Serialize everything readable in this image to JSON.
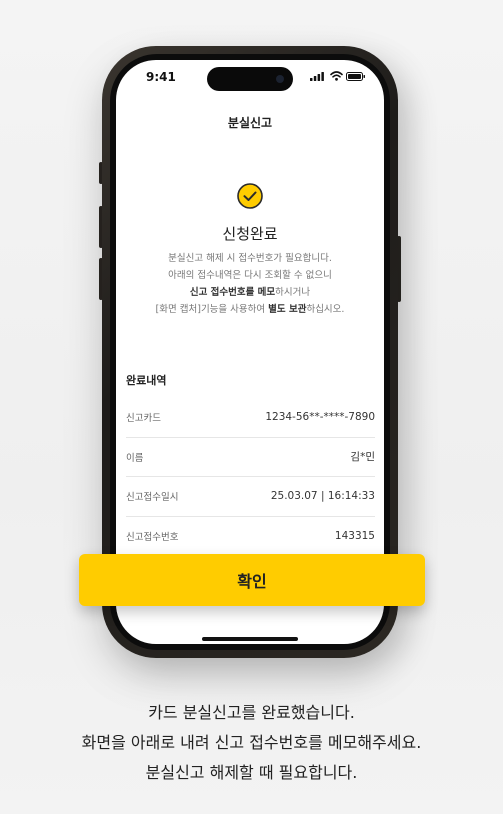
{
  "status_bar": {
    "time": "9:41"
  },
  "screen": {
    "header_title": "분실신고",
    "result_title": "신청완료",
    "description": {
      "line1": "분실신고 해제 시 접수번호가 필요합니다.",
      "line2": "아래의 접수내역은 다시 조회할 수 없으니",
      "line3_bold": "신고 접수번호를 메모",
      "line3_rest": "하시거나",
      "line4_pre": "[화면 캡처]기능을 사용하여 ",
      "line4_bold": "별도 보관",
      "line4_post": "하십시오."
    },
    "details_title": "완료내역",
    "details": [
      {
        "label": "신고카드",
        "value": "1234-56**-****-7890"
      },
      {
        "label": "이름",
        "value": "김*민"
      },
      {
        "label": "신고접수일시",
        "value": "25.03.07 | 16:14:33"
      },
      {
        "label": "신고접수번호",
        "value": "143315"
      }
    ]
  },
  "confirm_button": {
    "label": "확인"
  },
  "caption": {
    "line1": "카드 분실신고를 완료했습니다.",
    "line2": "화면을 아래로 내려 신고 접수번호를 메모해주세요.",
    "line3": "분실신고 해제할 때 필요합니다."
  },
  "colors": {
    "accent": "#ffcc00",
    "background": "#f1f1f1",
    "phone_frame": "#2a2622"
  },
  "icons": [
    "signal-icon",
    "wifi-icon",
    "battery-icon",
    "check-circle-icon"
  ]
}
